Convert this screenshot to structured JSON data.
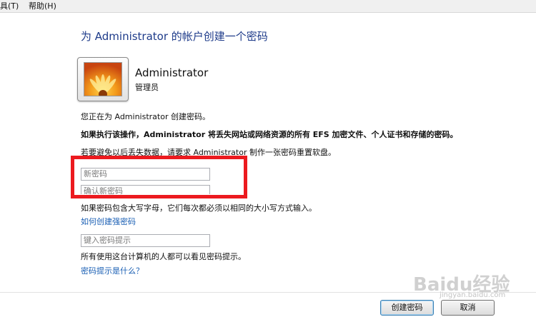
{
  "menubar": {
    "items": [
      "具(T)",
      "帮助(H)"
    ]
  },
  "page": {
    "title": "为 Administrator 的帐户创建一个密码"
  },
  "user": {
    "name": "Administrator",
    "role": "管理员"
  },
  "info": {
    "line1": "您正在为 Administrator 创建密码。",
    "warning": "如果执行该操作，Administrator 将丢失网站或网络资源的所有 EFS 加密文件、个人证书和存储的密码。",
    "line3": "若要避免以后丢失数据，请要求 Administrator 制作一张密码重置软盘。"
  },
  "form": {
    "new_password_placeholder": "新密码",
    "confirm_password_placeholder": "确认新密码",
    "case_note": "如果密码包含大写字母，它们每次都必须以相同的大小写方式输入。",
    "strong_password_link": "如何创建强密码",
    "hint_placeholder": "键入密码提示",
    "hint_note": "所有使用这台计算机的人都可以看见密码提示。",
    "hint_link": "密码提示是什么？"
  },
  "buttons": {
    "create": "创建密码",
    "cancel": "取消"
  },
  "watermark": {
    "text": "Baidu经验",
    "sub": "jingyan.baidu.com"
  },
  "colors": {
    "title": "#1e3b8a",
    "link": "#1a5fb4",
    "highlight": "#ec1a1f"
  }
}
